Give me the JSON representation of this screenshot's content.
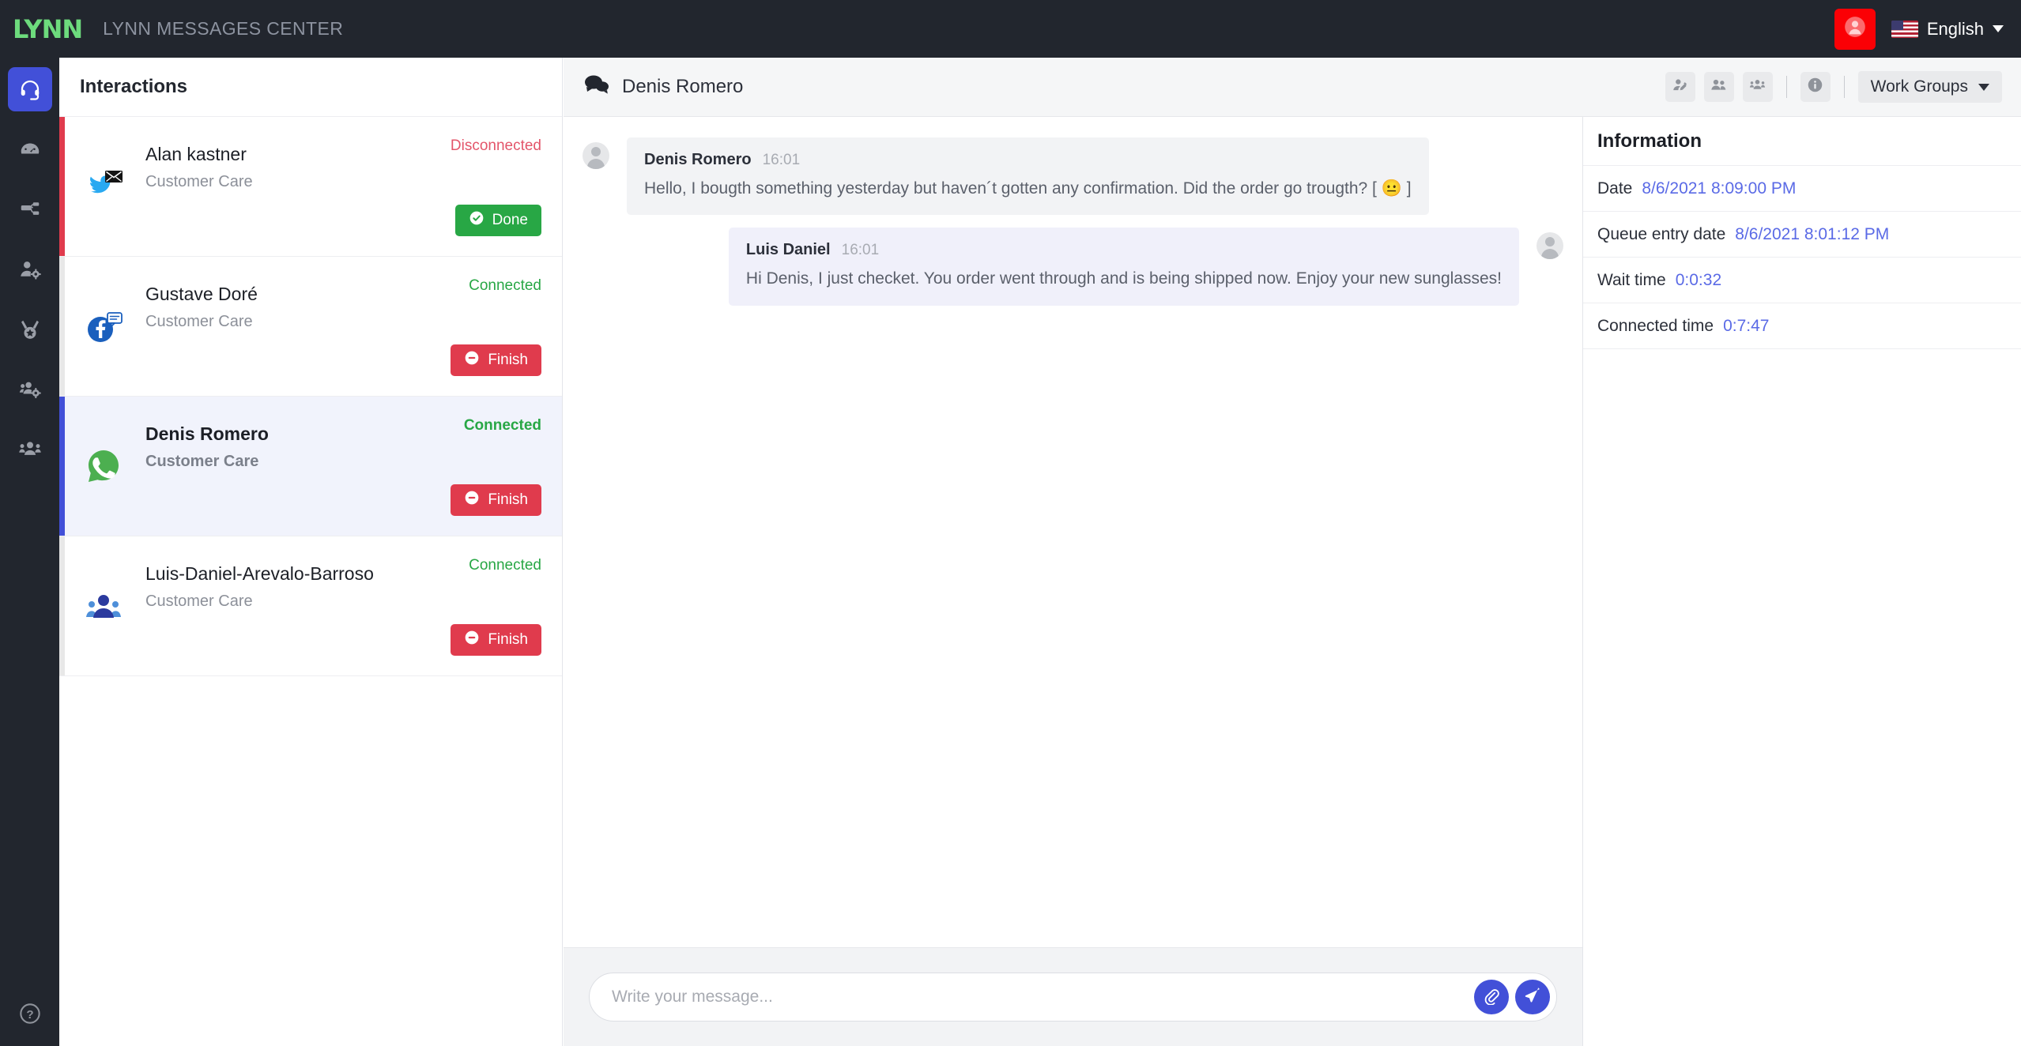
{
  "topbar": {
    "logo_text": "LYNN",
    "title": "LYNN MESSAGES CENTER",
    "user_icon": "user-circle-icon",
    "language": "English",
    "flag_icon": "us-flag-icon",
    "caret_icon": "chevron-down-icon"
  },
  "rail": {
    "items": [
      {
        "icon": "headset-icon",
        "active": true
      },
      {
        "icon": "dashboard-gauge-icon",
        "active": false
      },
      {
        "icon": "sitemap-network-icon",
        "active": false
      },
      {
        "icon": "user-gear-icon",
        "active": false
      },
      {
        "icon": "medal-award-icon",
        "active": false
      },
      {
        "icon": "users-gear-icon",
        "active": false
      },
      {
        "icon": "users-group-icon",
        "active": false
      }
    ],
    "help_icon": "question-circle-icon"
  },
  "interactions": {
    "header": "Interactions",
    "items": [
      {
        "name": "Alan kastner",
        "queue": "Customer Care",
        "status": "Disconnected",
        "status_state": "disconnected",
        "channel_icon": "twitter-dm-icon",
        "action_label": "Done",
        "action_type": "done",
        "action_icon": "check-circle-icon",
        "selected": false
      },
      {
        "name": "Gustave Doré",
        "queue": "Customer Care",
        "status": "Connected",
        "status_state": "connected",
        "channel_icon": "facebook-messenger-icon",
        "action_label": "Finish",
        "action_type": "finish",
        "action_icon": "minus-circle-icon",
        "selected": false
      },
      {
        "name": "Denis Romero",
        "queue": "Customer Care",
        "status": "Connected",
        "status_state": "connected",
        "channel_icon": "whatsapp-icon",
        "action_label": "Finish",
        "action_type": "finish",
        "action_icon": "minus-circle-icon",
        "selected": true
      },
      {
        "name": "Luis-Daniel-Arevalo-Barroso",
        "queue": "Customer Care",
        "status": "Connected",
        "status_state": "connected",
        "channel_icon": "teams-group-icon",
        "action_label": "Finish",
        "action_type": "finish",
        "action_icon": "minus-circle-icon",
        "selected": false
      }
    ]
  },
  "chat": {
    "title": "Denis Romero",
    "title_icon": "chat-bubbles-icon",
    "tools": [
      {
        "icon": "user-edit-icon"
      },
      {
        "icon": "two-users-icon"
      },
      {
        "icon": "user-group-icon"
      },
      {
        "icon": "info-circle-icon"
      }
    ],
    "workgroups_label": "Work Groups",
    "workgroups_caret": "chevron-down-icon",
    "messages": [
      {
        "author": "Denis Romero",
        "time": "16:01",
        "text": "Hello, I bougth something yesterday but haven´t gotten any confirmation. Did the order go trougth? [ 😐 ]",
        "direction": "inbound",
        "avatar_icon": "user-avatar-icon"
      },
      {
        "author": "Luis Daniel",
        "time": "16:01",
        "text": "Hi Denis, I just checket. You order went through and is being shipped now. Enjoy your new sunglasses!",
        "direction": "outbound",
        "avatar_icon": "user-avatar-icon"
      }
    ],
    "composer": {
      "placeholder": "Write your message...",
      "value": "",
      "attach_icon": "paperclip-icon",
      "send_icon": "paper-plane-icon"
    }
  },
  "information": {
    "title": "Information",
    "rows": [
      {
        "label": "Date",
        "value": "8/6/2021 8:09:00 PM"
      },
      {
        "label": "Queue entry date",
        "value": "8/6/2021 8:01:12 PM"
      },
      {
        "label": "Wait time",
        "value": "0:0:32"
      },
      {
        "label": "Connected time",
        "value": "0:7:47"
      }
    ]
  },
  "colors": {
    "accent_blue": "#4250d8",
    "danger_red": "#e03b4d",
    "success_green": "#28a745",
    "brand_green": "#6ddb7d",
    "dark_chrome": "#22262e",
    "info_value": "#5a6ae6"
  }
}
